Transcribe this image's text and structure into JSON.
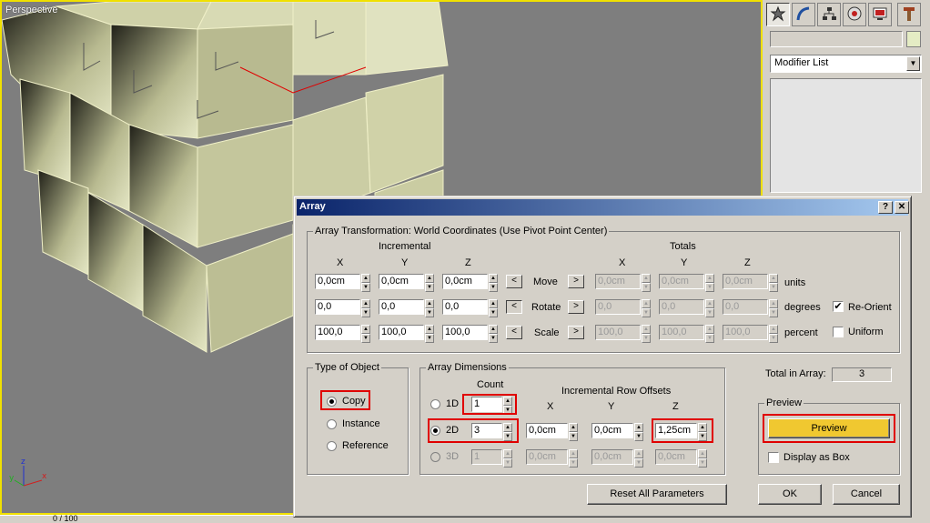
{
  "viewport": {
    "label": "Perspective",
    "status": "0 / 100"
  },
  "viewport_axes": {
    "x": "x",
    "y": "y",
    "z": "z"
  },
  "command_panel": {
    "tabs": [
      "create-icon",
      "modify-icon",
      "hierarchy-icon",
      "motion-icon",
      "display-icon",
      "utilities-icon"
    ],
    "modifier_list": "Modifier List",
    "object_color": "#e4ecc4"
  },
  "dialog": {
    "title": "Array",
    "help": "?",
    "close": "✕",
    "transform": {
      "legend": "Array Transformation: World Coordinates (Use Pivot Point Center)",
      "incremental_label": "Incremental",
      "totals_label": "Totals",
      "axes": [
        "X",
        "Y",
        "Z"
      ],
      "move": {
        "label": "Move",
        "inc": [
          "0,0cm",
          "0,0cm",
          "0,0cm"
        ],
        "tot": [
          "0,0cm",
          "0,0cm",
          "0,0cm"
        ],
        "unit": "units"
      },
      "rotate": {
        "label": "Rotate",
        "inc": [
          "0,0",
          "0,0",
          "0,0"
        ],
        "tot": [
          "0,0",
          "0,0",
          "0,0"
        ],
        "unit": "degrees"
      },
      "scale": {
        "label": "Scale",
        "inc": [
          "100,0",
          "100,0",
          "100,0"
        ],
        "tot": [
          "100,0",
          "100,0",
          "100,0"
        ],
        "unit": "percent"
      },
      "reorient": "Re-Orient",
      "uniform": "Uniform",
      "left_arrow": "<",
      "right_arrow": ">"
    },
    "type_of_object": {
      "legend": "Type of Object",
      "copy": "Copy",
      "instance": "Instance",
      "reference": "Reference"
    },
    "dimensions": {
      "legend": "Array Dimensions",
      "count_label": "Count",
      "row_offsets_label": "Incremental Row Offsets",
      "axes": [
        "X",
        "Y",
        "Z"
      ],
      "d1": {
        "label": "1D",
        "count": "1"
      },
      "d2": {
        "label": "2D",
        "count": "3",
        "offsets": [
          "0,0cm",
          "0,0cm",
          "1,25cm"
        ]
      },
      "d3": {
        "label": "3D",
        "count": "1",
        "offsets": [
          "0,0cm",
          "0,0cm",
          "0,0cm"
        ]
      }
    },
    "total_in_array": {
      "label": "Total in Array:",
      "value": "3"
    },
    "preview": {
      "legend": "Preview",
      "button": "Preview",
      "display_as_box": "Display as Box"
    },
    "reset": "Reset All Parameters",
    "ok": "OK",
    "cancel": "Cancel"
  }
}
